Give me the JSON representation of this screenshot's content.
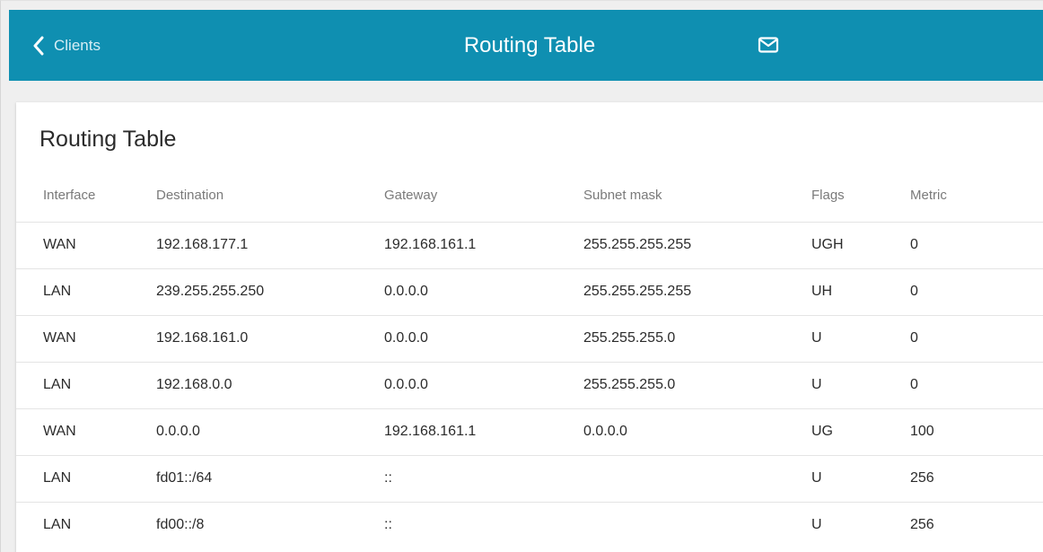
{
  "header": {
    "back_label": "Clients",
    "title": "Routing Table",
    "background_color": "#0f8fb1",
    "back_icon": "chevron-left-icon",
    "mail_icon": "mail-icon"
  },
  "card": {
    "title": "Routing Table"
  },
  "table": {
    "columns": [
      "Interface",
      "Destination",
      "Gateway",
      "Subnet mask",
      "Flags",
      "Metric"
    ],
    "rows": [
      [
        "WAN",
        "192.168.177.1",
        "192.168.161.1",
        "255.255.255.255",
        "UGH",
        "0"
      ],
      [
        "LAN",
        "239.255.255.250",
        "0.0.0.0",
        "255.255.255.255",
        "UH",
        "0"
      ],
      [
        "WAN",
        "192.168.161.0",
        "0.0.0.0",
        "255.255.255.0",
        "U",
        "0"
      ],
      [
        "LAN",
        "192.168.0.0",
        "0.0.0.0",
        "255.255.255.0",
        "U",
        "0"
      ],
      [
        "WAN",
        "0.0.0.0",
        "192.168.161.1",
        "0.0.0.0",
        "UG",
        "100"
      ],
      [
        "LAN",
        "fd01::/64",
        "::",
        "",
        "U",
        "256"
      ],
      [
        "LAN",
        "fd00::/8",
        "::",
        "",
        "U",
        "256"
      ]
    ]
  }
}
